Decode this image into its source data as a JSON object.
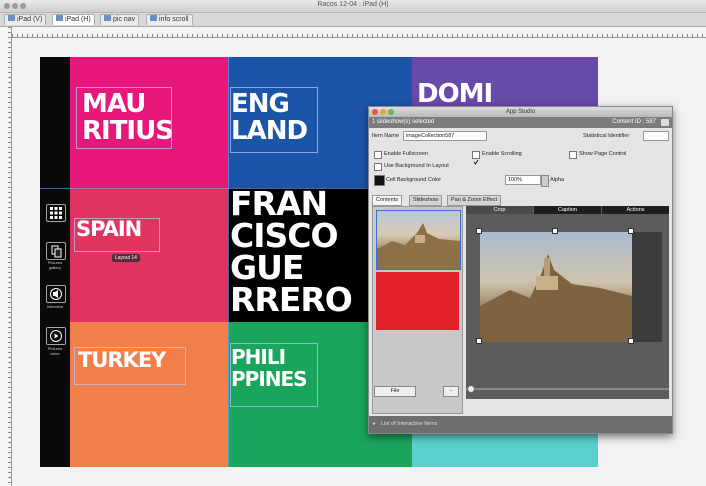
{
  "window": {
    "title": "Racos 12-04 : iPad (H)",
    "tabs": [
      "iPad (V)",
      "iPad (H)",
      "pic nav",
      "info scroll"
    ]
  },
  "page": {
    "cells": [
      {
        "name": "mauritius",
        "text": "MAU\nRITIUS",
        "color": "#e8177b"
      },
      {
        "name": "england",
        "text": "ENG\nLAND",
        "color": "#1c54a8"
      },
      {
        "name": "dominica",
        "text": "DOMI",
        "color": "#6a4aa8"
      },
      {
        "name": "spain",
        "text": "SPAIN",
        "color": "#e0345f"
      },
      {
        "name": "francisco",
        "text": "FRAN\nCISCO\nGUE\nRRERO",
        "color": "#000000"
      },
      {
        "name": "turkey",
        "text": "TURKEY",
        "color": "#f27f4a"
      },
      {
        "name": "philippines",
        "text": "PHILI\nPPINES",
        "color": "#1aa55c"
      },
      {
        "name": "teal",
        "text": "",
        "color": "#5ad0cc"
      }
    ],
    "layout_tip": "Layout 14",
    "sidebar_labels": [
      "Pictures gallery",
      "Interview",
      "Pictures video"
    ]
  },
  "panel": {
    "title": "App Studio",
    "selection": "1 slideshow(s) selected",
    "content_id": "Content ID : 587",
    "item_name_label": "Item Name",
    "item_name_value": "imageCollection587",
    "stat_id_label": "Statistical Identifier",
    "options": {
      "enable_fullscreen": "Enable Fullscreen",
      "enable_scrolling": "Enable Scrolling",
      "show_page_control": "Show Page Control",
      "use_background": "Use Background In Layout",
      "cell_bg": "Cell Background Color",
      "alpha_value": "100%",
      "alpha_label": "Alpha"
    },
    "tabs": [
      "Contents",
      "Slideshow",
      "Pan & Zoom Effect"
    ],
    "right_tabs": [
      "Crop",
      "Caption",
      "Actions"
    ],
    "file_button": "File",
    "minus_button": "-",
    "footer": "List of Interactive Items",
    "accent_red": "#e1202a"
  }
}
